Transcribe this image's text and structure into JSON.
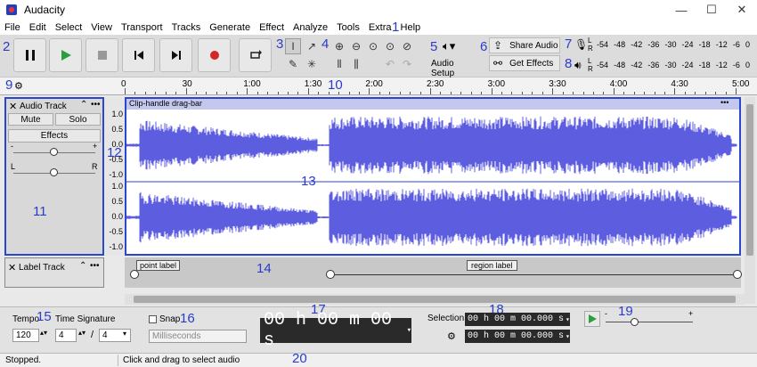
{
  "window": {
    "title": "Audacity",
    "minimize": "—",
    "maximize": "☐",
    "close": "✕"
  },
  "menu": [
    "File",
    "Edit",
    "Select",
    "View",
    "Transport",
    "Tracks",
    "Generate",
    "Effect",
    "Analyze",
    "Tools",
    "Extra",
    "Help"
  ],
  "toolbar": {
    "audio_setup": "Audio Setup",
    "share_audio": "Share Audio",
    "get_effects": "Get Effects"
  },
  "meters": {
    "record_ticks": [
      "-54",
      "-48",
      "-42",
      "-36",
      "-30",
      "-24",
      "-18",
      "-12",
      "-6",
      "0"
    ],
    "play_ticks": [
      "-54",
      "-48",
      "-42",
      "-36",
      "-30",
      "-24",
      "-18",
      "-12",
      "-6",
      "0"
    ],
    "channels": [
      "L",
      "R"
    ]
  },
  "ruler": {
    "ticks": [
      "0",
      "30",
      "1:00",
      "1:30",
      "2:00",
      "2:30",
      "3:00",
      "3:30",
      "4:00",
      "4:30",
      "5:00"
    ]
  },
  "audio_track": {
    "name": "Audio Track",
    "mute": "Mute",
    "solo": "Solo",
    "effects": "Effects",
    "gain_min": "-",
    "gain_max": "+",
    "pan_left": "L",
    "pan_right": "R",
    "clip_title": "Clip-handle drag-bar",
    "clip_menu": "•••",
    "scale": [
      "1.0",
      "0.5",
      "0.0",
      "-0.5",
      "-1.0"
    ]
  },
  "label_track": {
    "name": "Label Track",
    "point_label": "point label",
    "region_label": "region label"
  },
  "bottom": {
    "tempo_label": "Tempo",
    "tempo_value": "120",
    "timesig_label": "Time Signature",
    "timesig_num": "4",
    "timesig_sep": "/",
    "timesig_den": "4",
    "snap_label": "Snap",
    "snap_unit": "Milliseconds",
    "time_display": "00 h 00 m 00 s",
    "selection_label": "Selection",
    "sel_start": "00 h 00 m 00.000 s",
    "sel_end": "00 h 00 m 00.000 s",
    "speed_min": "-",
    "speed_max": "+"
  },
  "status": {
    "state": "Stopped.",
    "hint": "Click and drag to select audio"
  },
  "markers": [
    "1",
    "2",
    "3",
    "4",
    "5",
    "6",
    "7",
    "8",
    "9",
    "10",
    "11",
    "12",
    "13",
    "14",
    "15",
    "16",
    "17",
    "18",
    "19",
    "20"
  ],
  "colors": {
    "accent": "#2a3cc7",
    "wave": "#5d5de0",
    "waveBg": "#ffffff",
    "selected": "#2b47ce"
  }
}
